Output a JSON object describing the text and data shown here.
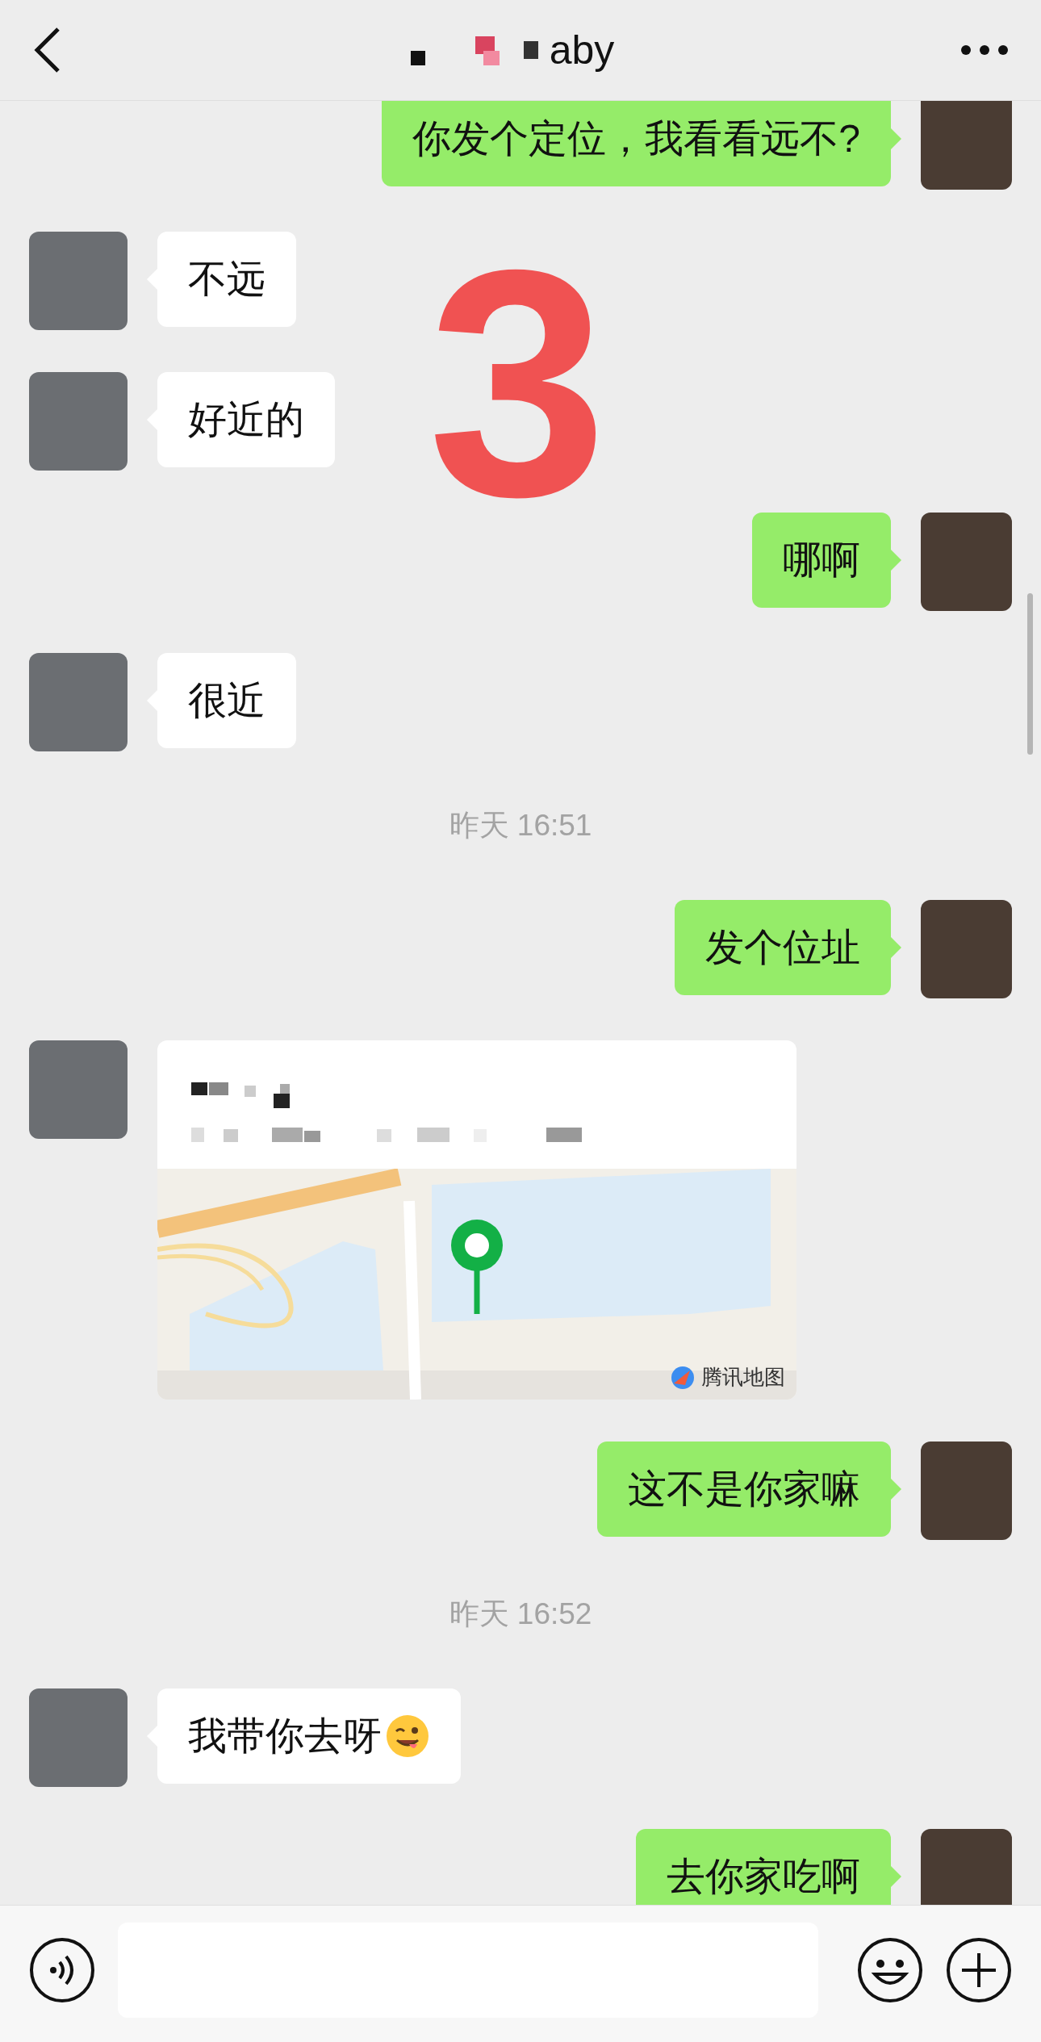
{
  "header": {
    "title": "aby"
  },
  "messages": [
    {
      "kind": "text",
      "outgoing": true,
      "text": "你发个定位，我看看远不?"
    },
    {
      "kind": "text",
      "outgoing": false,
      "text": "不远"
    },
    {
      "kind": "text",
      "outgoing": false,
      "text": "好近的"
    },
    {
      "kind": "text",
      "outgoing": true,
      "text": "哪啊"
    },
    {
      "kind": "text",
      "outgoing": false,
      "text": "很近"
    },
    {
      "kind": "time",
      "text": "昨天 16:51"
    },
    {
      "kind": "text",
      "outgoing": true,
      "text": "发个位址"
    },
    {
      "kind": "location",
      "outgoing": false,
      "map_label": "腾讯地图"
    },
    {
      "kind": "text",
      "outgoing": true,
      "text": "这不是你家嘛"
    },
    {
      "kind": "time",
      "text": "昨天 16:52"
    },
    {
      "kind": "text",
      "outgoing": false,
      "text": "我带你去呀",
      "emoji": true
    },
    {
      "kind": "text",
      "outgoing": true,
      "text": "去你家吃啊"
    }
  ],
  "overlay_number": "3"
}
